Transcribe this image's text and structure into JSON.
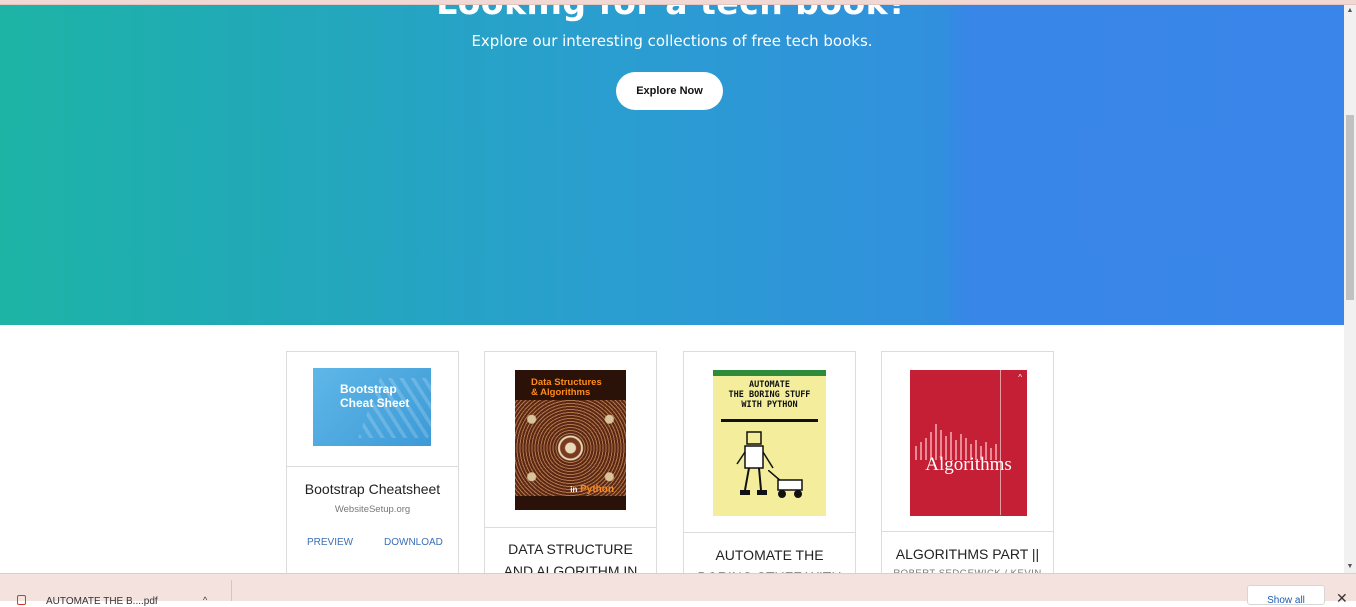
{
  "hero": {
    "title": "Looking for a tech book?",
    "subtitle": "Explore our interesting collections of free tech books.",
    "cta": "Explore Now"
  },
  "books": [
    {
      "title_lines": [
        "Bootstrap Cheatsheet"
      ],
      "publisher": "WebsiteSetup.org",
      "preview": "PREVIEW",
      "download": "DOWNLOAD",
      "cover": {
        "title_lines": [
          "Bootstrap",
          "Cheat Sheet"
        ],
        "color": "#4aa9e2"
      }
    },
    {
      "title_lines": [
        "DATA STRUCTURE",
        "AND ALGORITHM IN"
      ],
      "cover": {
        "title_lines": [
          "Data Structures",
          "& Algorithms"
        ],
        "lang_prefix": "in",
        "lang": "Python",
        "color": "#2a1209"
      }
    },
    {
      "title_lines": [
        "AUTOMATE THE",
        "BORING STUFF WITH"
      ],
      "cover": {
        "title_lines": [
          "AUTOMATE",
          "THE BORING STUFF",
          "WITH PYTHON"
        ],
        "color": "#f4ee9c"
      }
    },
    {
      "title_lines": [
        "ALGORITHMS PART ||"
      ],
      "author": "ROBERT SEDGEWICK / KEVIN",
      "cover": {
        "title": "Algorithms",
        "color": "#c41f35"
      }
    }
  ],
  "downloads_bar": {
    "file_name": "AUTOMATE THE B....pdf",
    "show_all": "Show all"
  },
  "colors": {
    "hero_start": "#1db4a6",
    "hero_end": "#3a85e9",
    "link": "#3b6fb6"
  }
}
